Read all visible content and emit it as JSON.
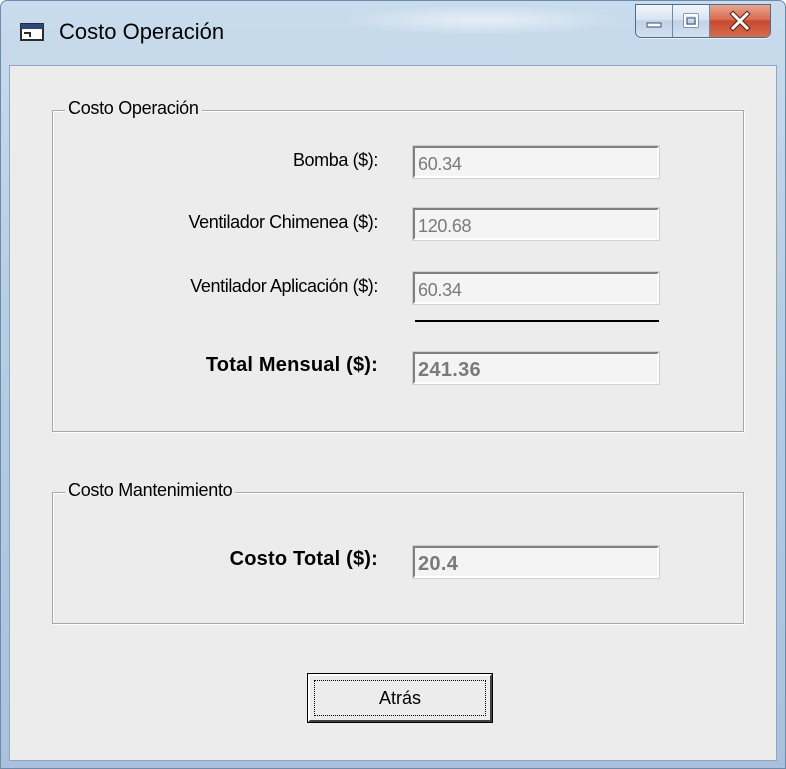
{
  "window": {
    "title": "Costo Operación"
  },
  "operacion_group": {
    "title": "Costo Operación",
    "fields": [
      {
        "label": "Bomba ($):",
        "value": "60.34"
      },
      {
        "label": "Ventilador Chimenea ($):",
        "value": "120.68"
      },
      {
        "label": "Ventilador Aplicación ($):",
        "value": "60.34"
      }
    ],
    "total": {
      "label": "Total Mensual ($):",
      "value": "241.36"
    }
  },
  "mantenimiento_group": {
    "title": "Costo Mantenimiento",
    "total": {
      "label": "Costo Total ($):",
      "value": "20.4"
    }
  },
  "back_button": {
    "label": "Atrás"
  },
  "icons": {
    "app": "form-window-icon",
    "minimize": "minimize-icon",
    "maximize": "maximize-icon",
    "close": "close-icon"
  }
}
